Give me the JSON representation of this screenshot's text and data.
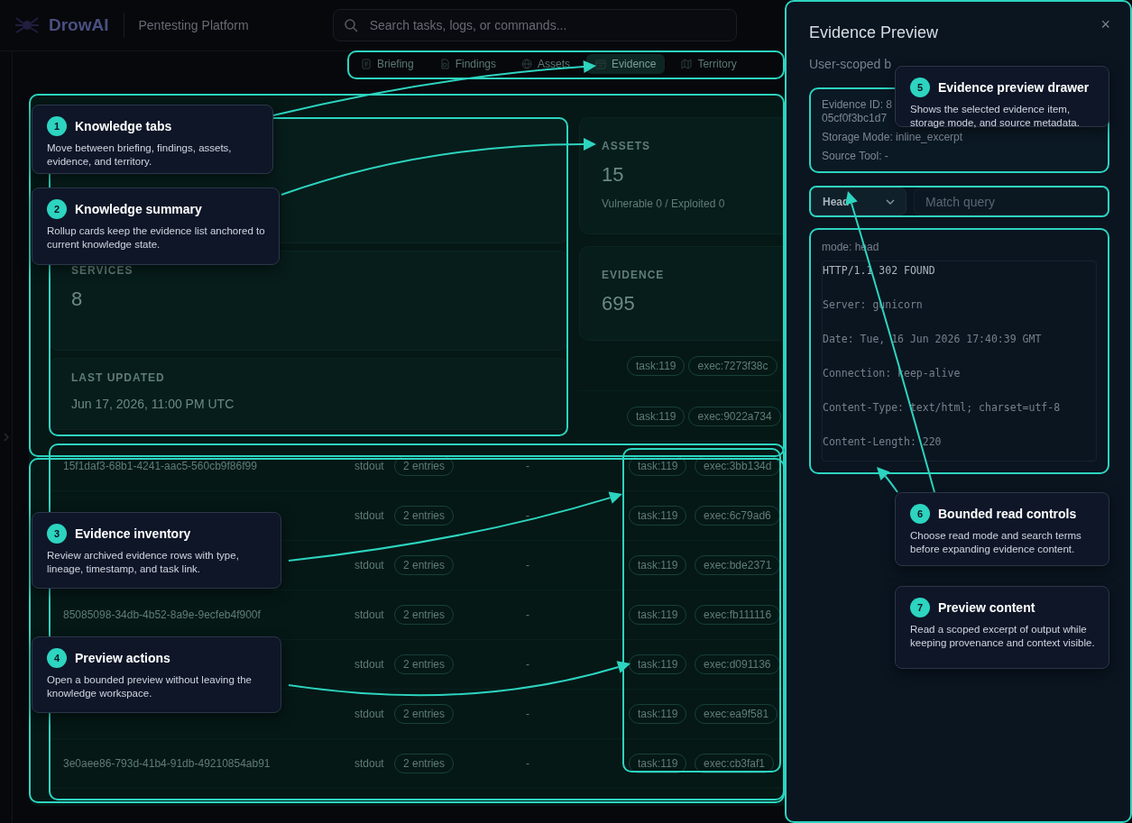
{
  "header": {
    "brand": "DrowAI",
    "subtitle": "Pentesting Platform",
    "search": {
      "placeholder": "Search tasks, logs, or commands..."
    }
  },
  "tabs": [
    {
      "label": "Briefing",
      "selected": false
    },
    {
      "label": "Findings",
      "selected": false
    },
    {
      "label": "Assets",
      "selected": false
    },
    {
      "label": "Evidence",
      "selected": true
    },
    {
      "label": "Territory",
      "selected": false
    }
  ],
  "summary": {
    "cards": [
      {
        "label": "SERVICES",
        "value": "8"
      },
      {
        "label": "LAST UPDATED",
        "value": "Jun 17, 2026, 11:00 PM UTC"
      }
    ],
    "side_cards": [
      {
        "label": "ASSETS",
        "value": "15",
        "note": "Vulnerable 0 / Exploited 0"
      },
      {
        "label": "EVIDENCE",
        "value": "695"
      }
    ]
  },
  "partial_rows": [
    {
      "task": "task:119",
      "exec": "exec:7273f38c"
    },
    {
      "task": "task:119",
      "exec": "exec:9022a734"
    }
  ],
  "rows": [
    {
      "id": "15f1daf3-68b1-4241-aac5-560cb9f86f99",
      "type": "stdout",
      "entries": "2 entries",
      "timestamp": "-",
      "task": "task:119",
      "exec": "exec:3bb134d"
    },
    {
      "type": "stdout",
      "entries": "2 entries",
      "timestamp": "-",
      "task": "task:119",
      "exec": "exec:6c79ad6"
    },
    {
      "type": "stdout",
      "entries": "2 entries",
      "timestamp": "-",
      "task": "task:119",
      "exec": "exec:bde2371"
    },
    {
      "id": "85085098-34db-4b52-8a9e-9ecfeb4f900f",
      "type": "stdout",
      "entries": "2 entries",
      "timestamp": "-",
      "task": "task:119",
      "exec": "exec:fb111116"
    },
    {
      "type": "stdout",
      "entries": "2 entries",
      "timestamp": "-",
      "task": "task:119",
      "exec": "exec:d091136"
    },
    {
      "type": "stdout",
      "entries": "2 entries",
      "timestamp": "-",
      "task": "task:119",
      "exec": "exec:ea9f581"
    },
    {
      "id": "3e0aee86-793d-41b4-91db-49210854ab91",
      "type": "stdout",
      "entries": "2 entries",
      "timestamp": "-",
      "task": "task:119",
      "exec": "exec:cb3faf1"
    }
  ],
  "drawer": {
    "title": "Evidence Preview",
    "close": "×",
    "subtitle": "User-scoped b",
    "id_lines": [
      "Evidence ID: 8",
      "05cf0f3bc1d7"
    ],
    "meta": [
      "Storage Mode: inline_excerpt",
      "Source Tool: -"
    ],
    "mode_select": "Head",
    "query": {
      "placeholder": "Match query"
    },
    "mode_label": "mode: head",
    "content": [
      "HTTP/1.1 302 FOUND",
      "Server: gunicorn",
      "Date: Tue, 16 Jun 2026 17:40:39 GMT",
      "Connection: keep-alive",
      "Content-Type: text/html; charset=utf-8",
      "Content-Length: 220"
    ]
  },
  "callouts": [
    {
      "number": "1",
      "title": "Knowledge tabs",
      "text": "Move between briefing, findings, assets, evidence, and territory."
    },
    {
      "number": "2",
      "title": "Knowledge summary",
      "text": "Rollup cards keep the evidence list anchored to current knowledge state."
    },
    {
      "number": "3",
      "title": "Evidence inventory",
      "text": "Review archived evidence rows with type, lineage, timestamp, and task link."
    },
    {
      "number": "4",
      "title": "Preview actions",
      "text": "Open a bounded preview without leaving the knowledge workspace."
    },
    {
      "number": "5",
      "title": "Evidence preview drawer",
      "text": "Shows the selected evidence item, storage mode, and source metadata."
    },
    {
      "number": "6",
      "title": "Bounded read controls",
      "text": "Choose read mode and search terms before expanding evidence content."
    },
    {
      "number": "7",
      "title": "Preview content",
      "text": "Read a scoped excerpt of output while keeping provenance and context visible."
    }
  ]
}
